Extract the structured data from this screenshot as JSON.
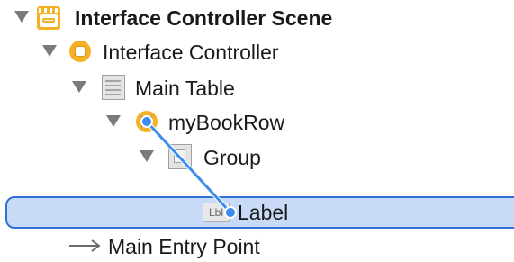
{
  "outline": {
    "items": [
      {
        "label": "Interface Controller Scene",
        "icon": "storyboard-scene-icon",
        "expanded": true
      },
      {
        "label": "Interface Controller",
        "icon": "interface-controller-icon",
        "expanded": true
      },
      {
        "label": "Main Table",
        "icon": "table-icon",
        "expanded": true
      },
      {
        "label": "myBookRow",
        "icon": "row-controller-icon",
        "expanded": true
      },
      {
        "label": "Group",
        "icon": "group-icon",
        "expanded": true
      },
      {
        "label": "Label",
        "icon": "label-icon",
        "selected": true,
        "icon_text": "Lbl"
      },
      {
        "label": "Main Entry Point",
        "icon": "entry-arrow-icon"
      }
    ]
  },
  "colors": {
    "selection_fill": "#c8daf6",
    "selection_border": "#2f6fd8",
    "connection_line": "#3a8cf0",
    "accent": "#f5b125"
  }
}
